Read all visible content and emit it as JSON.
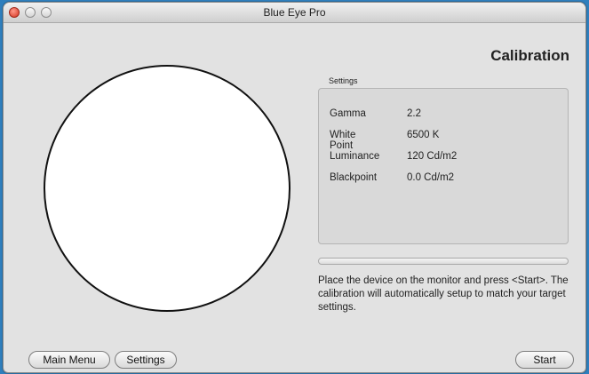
{
  "window": {
    "title": "Blue Eye Pro"
  },
  "header": {
    "title": "Calibration"
  },
  "settings": {
    "label": "Settings",
    "rows": [
      {
        "key": "Gamma",
        "value": "2.2"
      },
      {
        "key": "White Point",
        "value": "6500 K"
      },
      {
        "key": "Luminance",
        "value": "120 Cd/m2"
      },
      {
        "key": "Blackpoint",
        "value": "0.0 Cd/m2"
      }
    ]
  },
  "progress": {
    "value": 0
  },
  "instructions": "Place the device on the monitor and press <Start>. The calibration will automatically setup to match your target settings.",
  "buttons": {
    "main_menu": "Main Menu",
    "settings": "Settings",
    "start": "Start"
  }
}
